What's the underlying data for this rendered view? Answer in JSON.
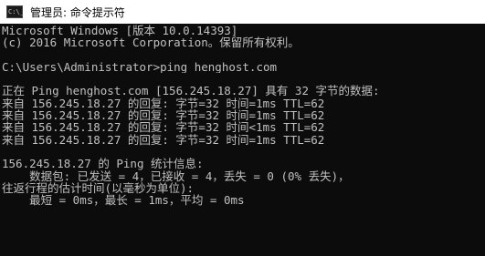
{
  "window": {
    "title": "管理员: 命令提示符",
    "icon": "cmd-icon"
  },
  "console": {
    "lines": [
      "Microsoft Windows [版本 10.0.14393]",
      "(c) 2016 Microsoft Corporation。保留所有权利。",
      "",
      "C:\\Users\\Administrator>ping henghost.com",
      "",
      "正在 Ping henghost.com [156.245.18.27] 具有 32 字节的数据:",
      "来自 156.245.18.27 的回复: 字节=32 时间=1ms TTL=62",
      "来自 156.245.18.27 的回复: 字节=32 时间=1ms TTL=62",
      "来自 156.245.18.27 的回复: 字节=32 时间<1ms TTL=62",
      "来自 156.245.18.27 的回复: 字节=32 时间=1ms TTL=62",
      "",
      "156.245.18.27 的 Ping 统计信息:",
      "    数据包: 已发送 = 4，已接收 = 4，丢失 = 0 (0% 丢失)，",
      "往返行程的估计时间(以毫秒为单位):",
      "    最短 = 0ms，最长 = 1ms，平均 = 0ms"
    ]
  }
}
